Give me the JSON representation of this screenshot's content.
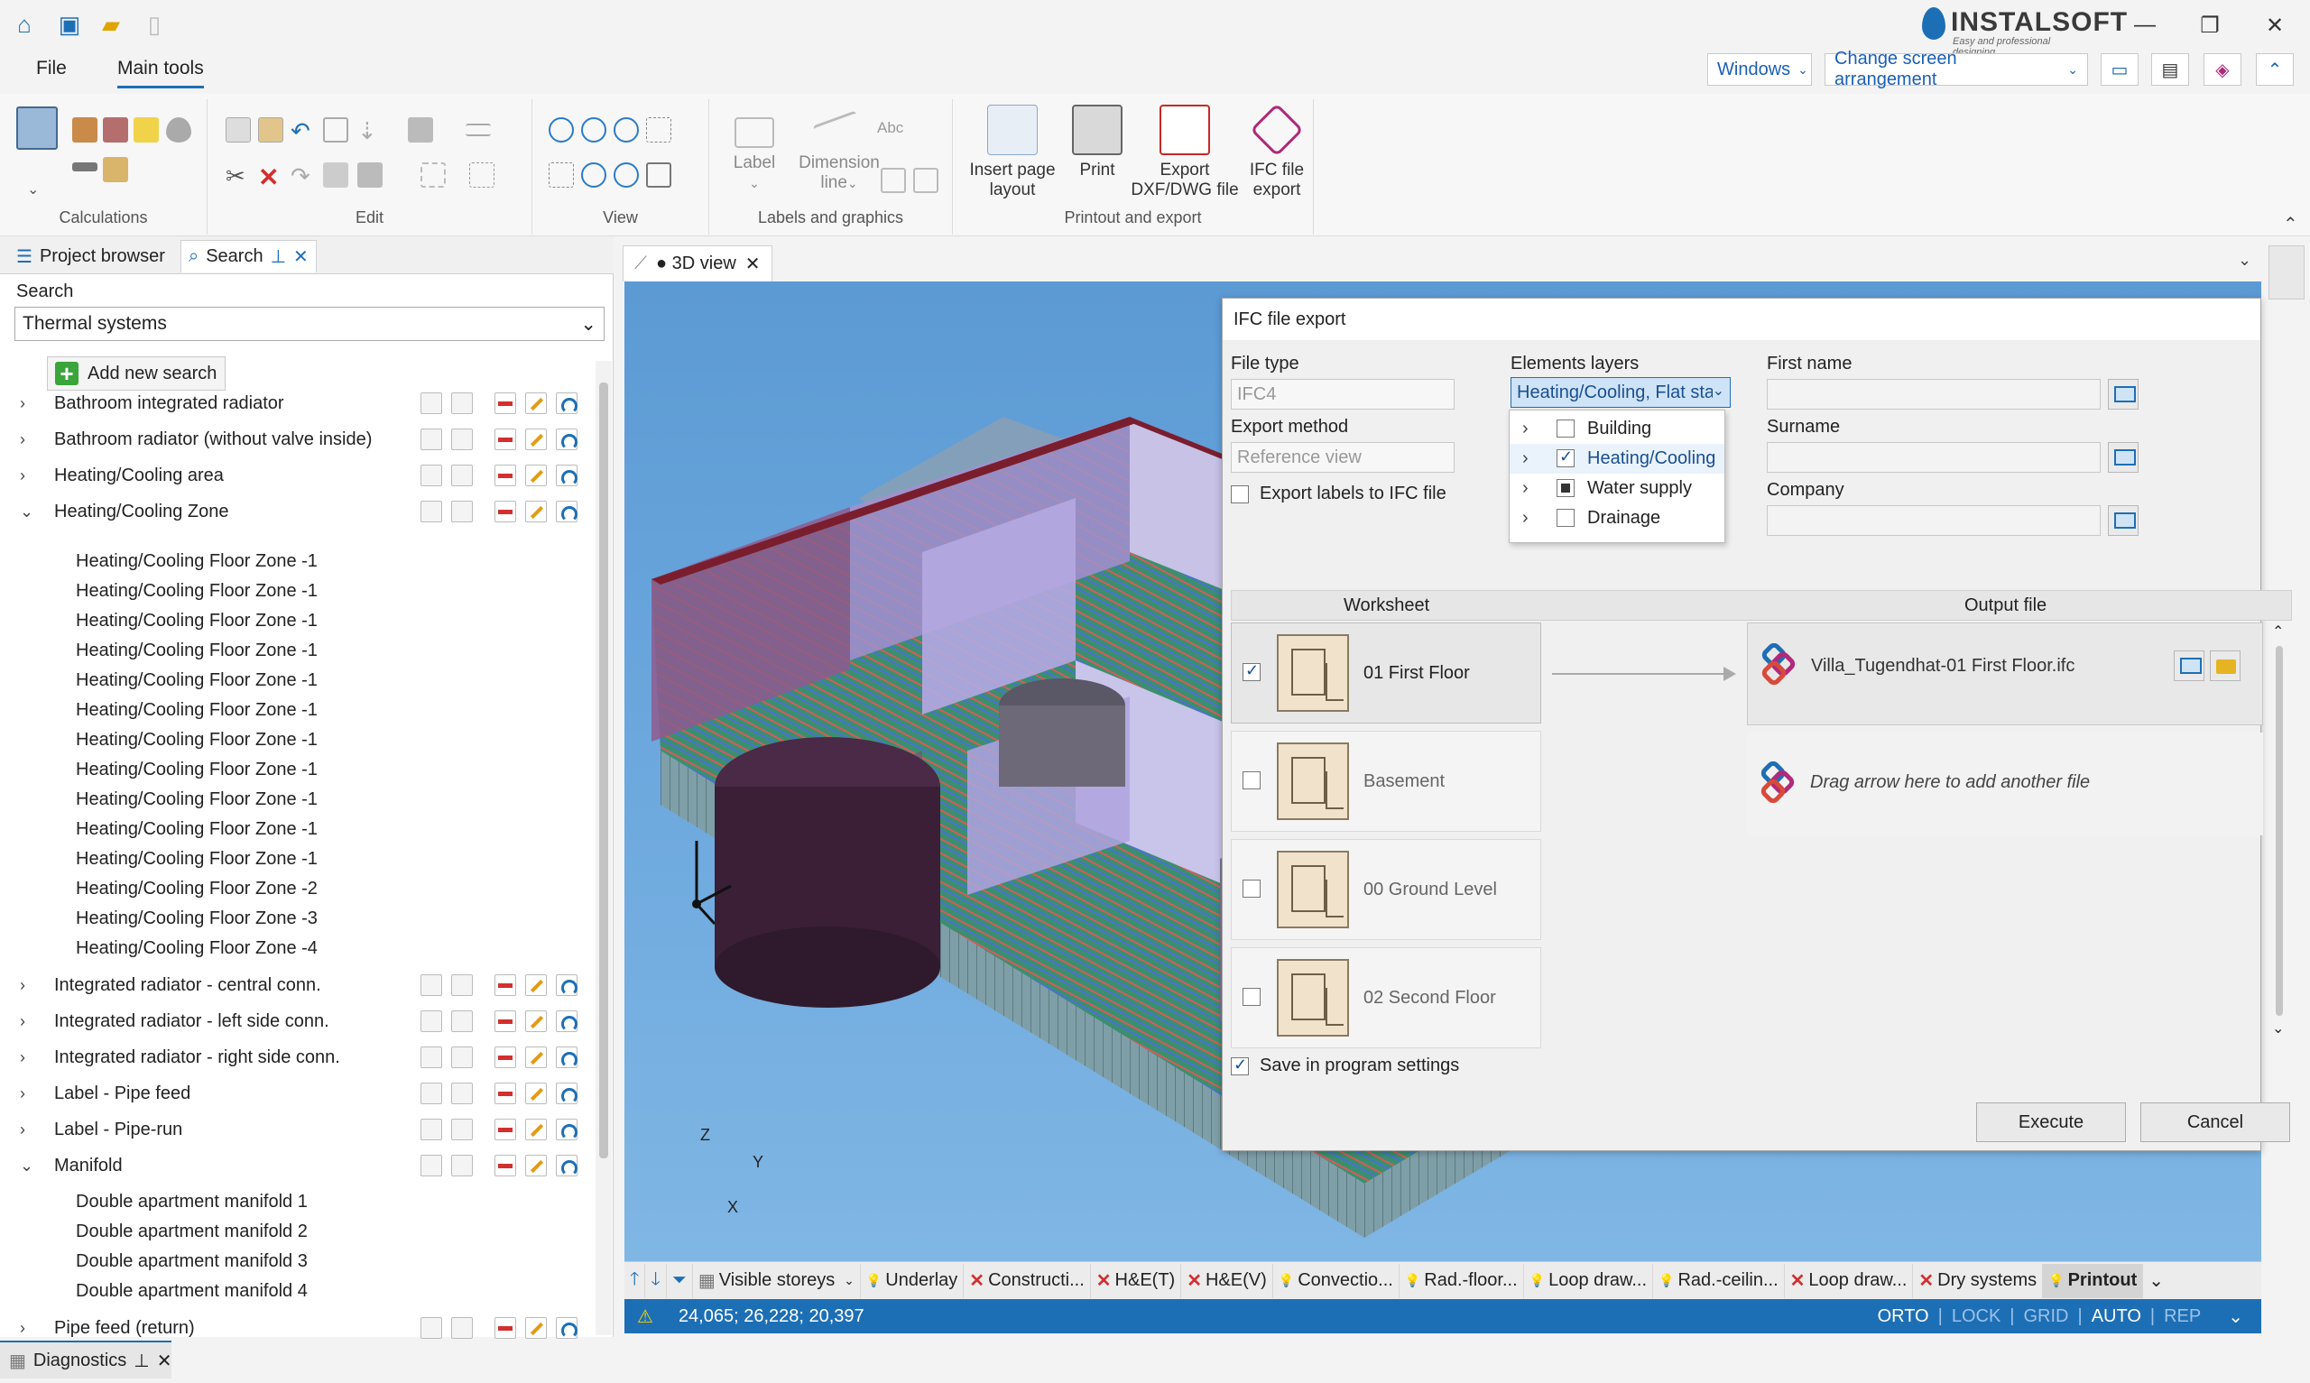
{
  "app": {
    "brand": "INSTALSOFT",
    "brand_tagline": "Easy and professional designing"
  },
  "menu": {
    "file": "File",
    "main_tools": "Main tools"
  },
  "topbar": {
    "windows": "Windows",
    "change_arrangement": "Change screen arrangement"
  },
  "ribbon": {
    "groups": {
      "calculations": "Calculations",
      "edit": "Edit",
      "view": "View",
      "labels_graphics": "Labels and graphics",
      "printout_export": "Printout and export"
    },
    "label_btn": "Label",
    "dimension_line": "Dimension",
    "dimension_line2": "line",
    "abc": "Abc",
    "insert_page_layout": "Insert page",
    "insert_page_layout2": "layout",
    "print": "Print",
    "export_dxf": "Export",
    "export_dxf2": "DXF/DWG file",
    "ifc_export": "IFC file",
    "ifc_export2": "export"
  },
  "left_panel": {
    "tab_project_browser": "Project browser",
    "tab_search": "Search",
    "search_label": "Search",
    "search_value": "Thermal systems",
    "add_new_search": "Add new search",
    "tree": [
      {
        "label": "Bathroom integrated radiator",
        "expanded": false
      },
      {
        "label": "Bathroom radiator (without valve inside)",
        "expanded": false
      },
      {
        "label": "Heating/Cooling area",
        "expanded": false
      },
      {
        "label": "Heating/Cooling Zone",
        "expanded": true
      },
      {
        "label": "Heating/Cooling Floor Zone -1",
        "child": true
      },
      {
        "label": "Heating/Cooling Floor Zone -1",
        "child": true
      },
      {
        "label": "Heating/Cooling Floor Zone -1",
        "child": true
      },
      {
        "label": "Heating/Cooling Floor Zone -1",
        "child": true
      },
      {
        "label": "Heating/Cooling Floor Zone -1",
        "child": true
      },
      {
        "label": "Heating/Cooling Floor Zone -1",
        "child": true
      },
      {
        "label": "Heating/Cooling Floor Zone -1",
        "child": true
      },
      {
        "label": "Heating/Cooling Floor Zone -1",
        "child": true
      },
      {
        "label": "Heating/Cooling Floor Zone -1",
        "child": true
      },
      {
        "label": "Heating/Cooling Floor Zone -1",
        "child": true
      },
      {
        "label": "Heating/Cooling Floor Zone -1",
        "child": true
      },
      {
        "label": "Heating/Cooling Floor Zone -2",
        "child": true
      },
      {
        "label": "Heating/Cooling Floor Zone -3",
        "child": true
      },
      {
        "label": "Heating/Cooling Floor Zone -4",
        "child": true
      },
      {
        "label": "Integrated radiator - central conn.",
        "expanded": false
      },
      {
        "label": "Integrated radiator - left side conn.",
        "expanded": false
      },
      {
        "label": "Integrated radiator - right side conn.",
        "expanded": false
      },
      {
        "label": "Label - Pipe feed",
        "expanded": false
      },
      {
        "label": "Label - Pipe-run",
        "expanded": false
      },
      {
        "label": "Manifold",
        "expanded": true
      },
      {
        "label": "Double apartment manifold 1",
        "child": true
      },
      {
        "label": "Double apartment manifold 2",
        "child": true
      },
      {
        "label": "Double apartment manifold 3",
        "child": true
      },
      {
        "label": "Double apartment manifold 4",
        "child": true
      },
      {
        "label": "Pipe feed (return)",
        "expanded": false
      }
    ],
    "diagnostics": "Diagnostics"
  },
  "view": {
    "tab_label": "● 3D view",
    "axes": {
      "z": "Z",
      "y": "Y",
      "x": "X"
    }
  },
  "bottom_toolbar": {
    "visible_storeys": "Visible storeys",
    "items": [
      {
        "label": "Underlay",
        "state": "on"
      },
      {
        "label": "Constructi...",
        "state": "off"
      },
      {
        "label": "H&E(T)",
        "state": "off"
      },
      {
        "label": "H&E(V)",
        "state": "off"
      },
      {
        "label": "Convectio...",
        "state": "on"
      },
      {
        "label": "Rad.-floor...",
        "state": "on"
      },
      {
        "label": "Loop draw...",
        "state": "on"
      },
      {
        "label": "Rad.-ceilin...",
        "state": "on"
      },
      {
        "label": "Loop draw...",
        "state": "off"
      },
      {
        "label": "Dry systems",
        "state": "off"
      },
      {
        "label": "Printout",
        "state": "on"
      }
    ]
  },
  "status": {
    "coords": "24,065; 26,228; 20,397",
    "orto": "ORTO",
    "lock": "LOCK",
    "grid": "GRID",
    "auto": "AUTO",
    "rep": "REP"
  },
  "dialog": {
    "title": "IFC file export",
    "file_type_label": "File type",
    "file_type_value": "IFC4",
    "export_method_label": "Export method",
    "export_method_value": "Reference view",
    "export_labels": "Export labels  to IFC file",
    "elements_layers_label": "Elements layers",
    "elements_layers_value": "Heating/Cooling, Flat sta",
    "layers": [
      {
        "label": "Building",
        "state": "unchecked"
      },
      {
        "label": "Heating/Cooling",
        "state": "checked"
      },
      {
        "label": "Water supply",
        "state": "partial"
      },
      {
        "label": "Drainage",
        "state": "unchecked"
      }
    ],
    "first_name_label": "First name",
    "surname_label": "Surname",
    "company_label": "Company",
    "worksheet_header": "Worksheet",
    "output_header": "Output file",
    "worksheets": [
      {
        "name": "01 First Floor",
        "checked": true
      },
      {
        "name": "Basement",
        "checked": false
      },
      {
        "name": "00 Ground Level",
        "checked": false
      },
      {
        "name": "02 Second Floor",
        "checked": false
      }
    ],
    "output_file": "Villa_Tugendhat-01 First Floor.ifc",
    "drop_hint": "Drag arrow here to add another file",
    "save_settings": "Save in program settings",
    "execute": "Execute",
    "cancel": "Cancel"
  }
}
